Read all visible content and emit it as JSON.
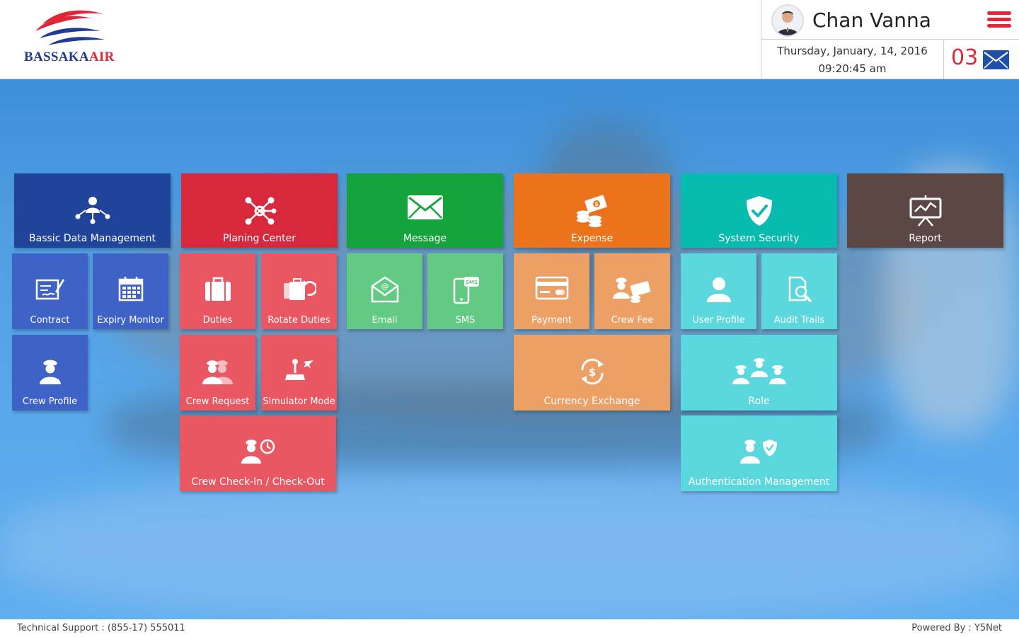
{
  "header": {
    "logo_text_main": "BASSAKA",
    "logo_text_accent": "AIR",
    "user_name": "Chan Vanna",
    "date": "Thursday, January, 14, 2016",
    "time": "09:20:45 am",
    "message_count": "03"
  },
  "colors": {
    "blue_primary": "#21449b",
    "blue_secondary": "#3e62c6",
    "red_primary": "#d8283b",
    "red_secondary": "#e95862",
    "green_primary": "#15a43c",
    "green_secondary": "#63ca83",
    "orange_primary": "#ec731c",
    "orange_secondary": "#eda066",
    "teal_primary": "#07bcae",
    "teal_secondary": "#5bd8de",
    "brown_primary": "#5b4845",
    "accent_red": "#e0283a"
  },
  "tiles": {
    "basic_data": "Bassic Data Management",
    "contract": "Contract",
    "expiry_monitor": "Expiry Monitor",
    "crew_profile": "Crew Profile",
    "planing_center": "Planing Center",
    "duties": "Duties",
    "rotate_duties": "Rotate Duties",
    "crew_request": "Crew Request",
    "simulator_mode": "Simulator Mode",
    "crew_check": "Crew Check-In / Check-Out",
    "message": "Message",
    "email": "Email",
    "sms": "SMS",
    "expense": "Expense",
    "payment": "Payment",
    "crew_fee": "Crew Fee",
    "currency_exchange": "Currency Exchange",
    "system_security": "System Security",
    "user_profile": "User Profile",
    "audit_trails": "Audit Trails",
    "role": "Role",
    "auth_mgmt": "Authentication Management",
    "report": "Report"
  },
  "footer": {
    "support": "Technical Support :  (855-17) 555011",
    "powered": "Powered By : Y5Net"
  }
}
